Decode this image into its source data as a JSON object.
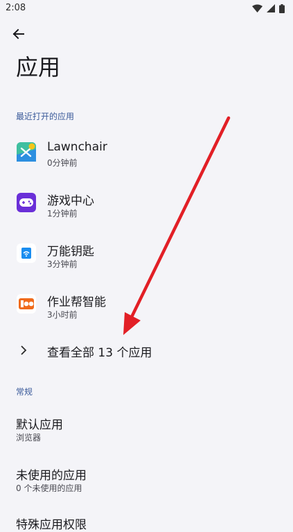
{
  "status_bar": {
    "time": "2:08"
  },
  "header": {
    "title": "应用"
  },
  "recent": {
    "label": "最近打开的应用",
    "apps": [
      {
        "name": "Lawnchair",
        "sub": "0分钟前",
        "icon": "lawnchair-icon"
      },
      {
        "name": "游戏中心",
        "sub": "1分钟前",
        "icon": "gamepad-icon"
      },
      {
        "name": "万能钥匙",
        "sub": "3分钟前",
        "icon": "wifi-key-icon"
      },
      {
        "name": "作业帮智能",
        "sub": "3小时前",
        "icon": "zuoyebang-icon"
      }
    ],
    "see_all": "查看全部 13 个应用"
  },
  "general": {
    "label": "常规",
    "items": [
      {
        "title": "默认应用",
        "sub": "浏览器"
      },
      {
        "title": "未使用的应用",
        "sub": "0 个未使用的应用"
      },
      {
        "title": "特殊应用权限",
        "sub": ""
      }
    ]
  },
  "colors": {
    "accent": "#3a5a9a",
    "annotation_arrow": "#e21f26"
  }
}
